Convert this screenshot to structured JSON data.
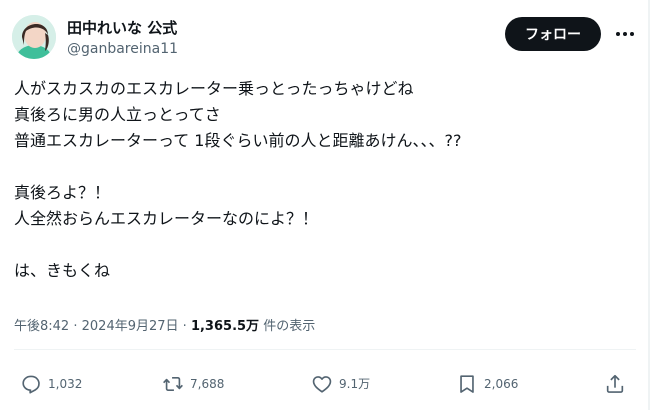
{
  "author": {
    "display_name": "田中れいな 公式",
    "handle": "@ganbareina11",
    "avatar": "avatar-photo"
  },
  "follow_label": "フォロー",
  "tweet": {
    "lines": [
      "人がスカスカのエスカレーター乗っとったっちゃけどね",
      "真後ろに男の人立っとってさ",
      "普通エスカレーターって 1段ぐらい前の人と距離あけん、、、??",
      "",
      "真後ろよ？！",
      "人全然おらんエスカレーターなのによ？！",
      "",
      "は、きもくね"
    ]
  },
  "meta": {
    "time": "午後8:42",
    "separator": "·",
    "date": "2024年9月27日",
    "views_count": "1,365.5万",
    "views_label": "件の表示"
  },
  "actions": {
    "reply": {
      "icon": "reply-icon",
      "count": "1,032"
    },
    "repost": {
      "icon": "repost-icon",
      "count": "7,688"
    },
    "like": {
      "icon": "heart-icon",
      "count": "9.1万"
    },
    "bookmark": {
      "icon": "bookmark-icon",
      "count": "2,066"
    },
    "share": {
      "icon": "share-icon"
    }
  },
  "colors": {
    "text": "#0f1419",
    "secondary": "#536471",
    "follow_bg": "#0f1419",
    "follow_text": "#ffffff",
    "divider": "#eff3f4"
  }
}
